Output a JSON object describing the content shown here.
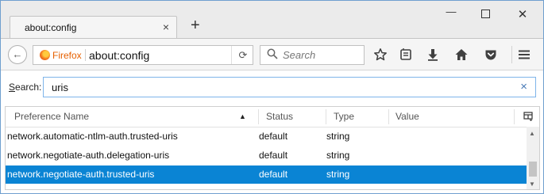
{
  "browser": {
    "tab": {
      "title": "about:config",
      "close_glyph": "×"
    },
    "new_tab_glyph": "+",
    "window_controls": {
      "minimize": "—",
      "maximize": "",
      "close": "✕"
    }
  },
  "navbar": {
    "back_glyph": "←",
    "identity_label": "Firefox",
    "url": "about:config",
    "reload_glyph": "⟳",
    "search_placeholder": "Search",
    "icons": [
      "star-icon",
      "reading-list-icon",
      "download-icon",
      "home-icon",
      "pocket-icon",
      "menu-icon"
    ]
  },
  "config_search": {
    "label_prefix": "",
    "label_underlined": "S",
    "label_rest": "earch:",
    "value": "uris",
    "clear_glyph": "×"
  },
  "table": {
    "columns": [
      "Preference Name",
      "Status",
      "Type",
      "Value"
    ],
    "sorted_column": "Preference Name",
    "sort_glyph": "▲",
    "rows": [
      {
        "name": "network.automatic-ntlm-auth.trusted-uris",
        "status": "default",
        "type": "string",
        "value": ""
      },
      {
        "name": "network.negotiate-auth.delegation-uris",
        "status": "default",
        "type": "string",
        "value": ""
      },
      {
        "name": "network.negotiate-auth.trusted-uris",
        "status": "default",
        "type": "string",
        "value": ""
      }
    ],
    "selected_row": 2
  },
  "colors": {
    "selection": "#0a84d4",
    "firefox_label": "#e66000",
    "window_border": "#6f9fcf"
  }
}
